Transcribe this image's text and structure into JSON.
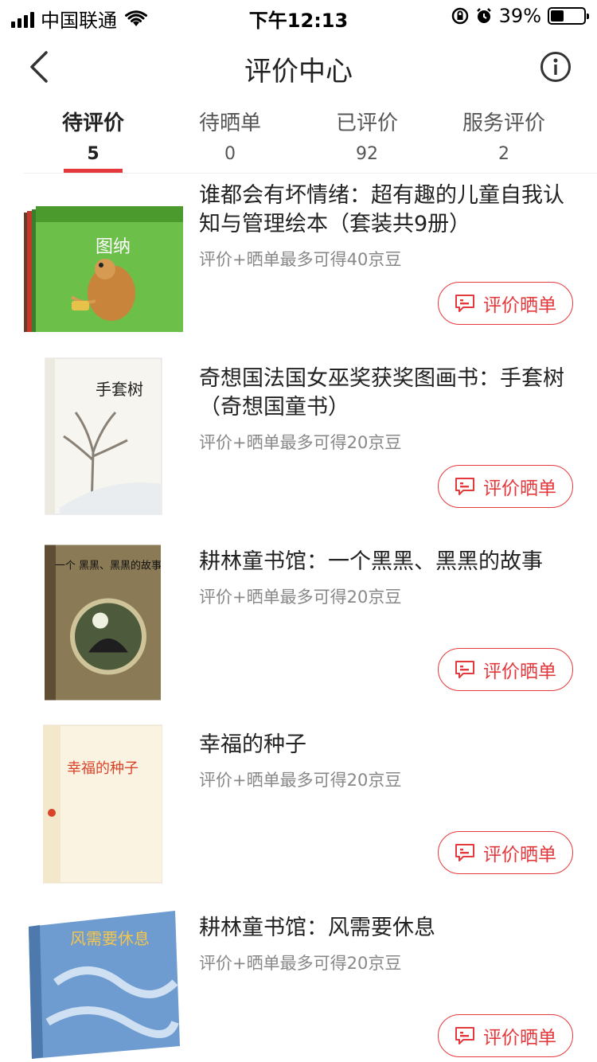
{
  "status": {
    "carrier": "中国联通",
    "time": "下午12:13",
    "battery": "39%",
    "battery_level": 0.39
  },
  "nav": {
    "title": "评价中心",
    "back_icon": "chevron-left-icon",
    "info_icon": "info-icon"
  },
  "tabs": [
    {
      "label": "待评价",
      "count": "5"
    },
    {
      "label": "待晒单",
      "count": "0"
    },
    {
      "label": "已评价",
      "count": "92"
    },
    {
      "label": "服务评价",
      "count": "2"
    }
  ],
  "active_tab": 0,
  "accent_color": "#e4393c",
  "items": [
    {
      "title": "谁都会有坏情绪：超有趣的儿童自我认知与管理绘本（套装共9册）",
      "reward": "评价+晒单最多可得40京豆",
      "button": "评价晒单",
      "cover_text": "图纳"
    },
    {
      "title": "奇想国法国女巫奖获奖图画书：手套树（奇想国童书）",
      "reward": "评价+晒单最多可得20京豆",
      "button": "评价晒单",
      "cover_text": "手套树"
    },
    {
      "title": "耕林童书馆：一个黑黑、黑黑的故事",
      "reward": "评价+晒单最多可得20京豆",
      "button": "评价晒单",
      "cover_text": "一个 黑黑、黑黑的故事"
    },
    {
      "title": "幸福的种子",
      "reward": "评价+晒单最多可得20京豆",
      "button": "评价晒单",
      "cover_text": "幸福的种子"
    },
    {
      "title": "耕林童书馆：风需要休息",
      "reward": "评价+晒单最多可得20京豆",
      "button": "评价晒单",
      "cover_text": "风需要休息"
    }
  ]
}
